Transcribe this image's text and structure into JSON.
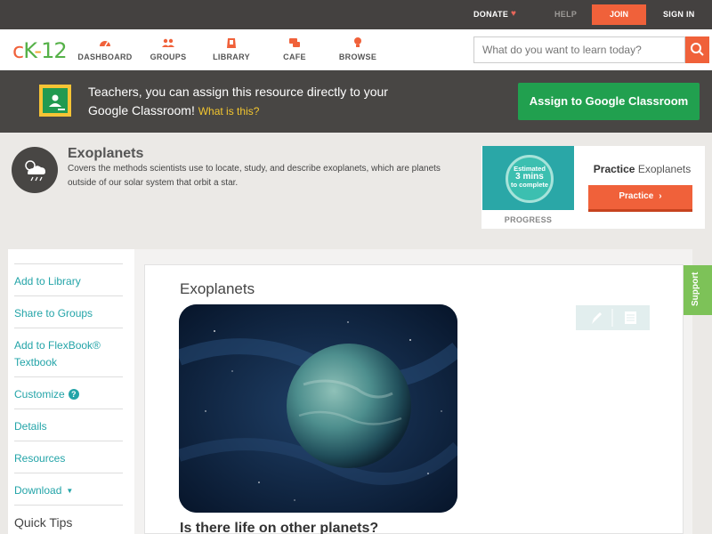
{
  "topbar": {
    "donate": "DONATE",
    "help": "HELP",
    "join": "JOIN",
    "signin": "SIGN IN"
  },
  "nav": {
    "logo": {
      "c": "c",
      "k": "K",
      "dash": "-",
      "num": "12"
    },
    "items": [
      {
        "label": "DASHBOARD",
        "icon": "dashboard-icon"
      },
      {
        "label": "GROUPS",
        "icon": "groups-icon"
      },
      {
        "label": "LIBRARY",
        "icon": "library-icon"
      },
      {
        "label": "CAFE",
        "icon": "cafe-icon"
      },
      {
        "label": "BROWSE",
        "icon": "browse-icon"
      }
    ],
    "search_placeholder": "What do you want to learn today?"
  },
  "banner": {
    "text": "Teachers, you can assign this resource directly to your Google Classroom!",
    "what_link": "What is this?",
    "assign_button": "Assign to Google Classroom"
  },
  "topic": {
    "title": "Exoplanets",
    "description": "Covers the methods scientists use to locate, study, and describe exoplanets, which are planets outside of our solar system that orbit a star."
  },
  "practice": {
    "badge_line1": "Estimated",
    "badge_line2": "3 mins",
    "badge_line3": "to complete",
    "progress_label": "PROGRESS",
    "title_bold": "Practice",
    "title_rest": "Exoplanets",
    "button": "Practice"
  },
  "sidebar": {
    "items": [
      "Add to Library",
      "Share to Groups",
      "Add to FlexBook® Textbook",
      "Customize",
      "Details",
      "Resources",
      "Download",
      "Quick Tips"
    ],
    "customize_help": "?"
  },
  "content": {
    "title": "Exoplanets",
    "subheading": "Is there life on other planets?"
  },
  "support": "Support",
  "colors": {
    "accent": "#f0613a",
    "teal": "#23a4a8",
    "google_green": "#21a04f",
    "support_green": "#7dc258"
  }
}
